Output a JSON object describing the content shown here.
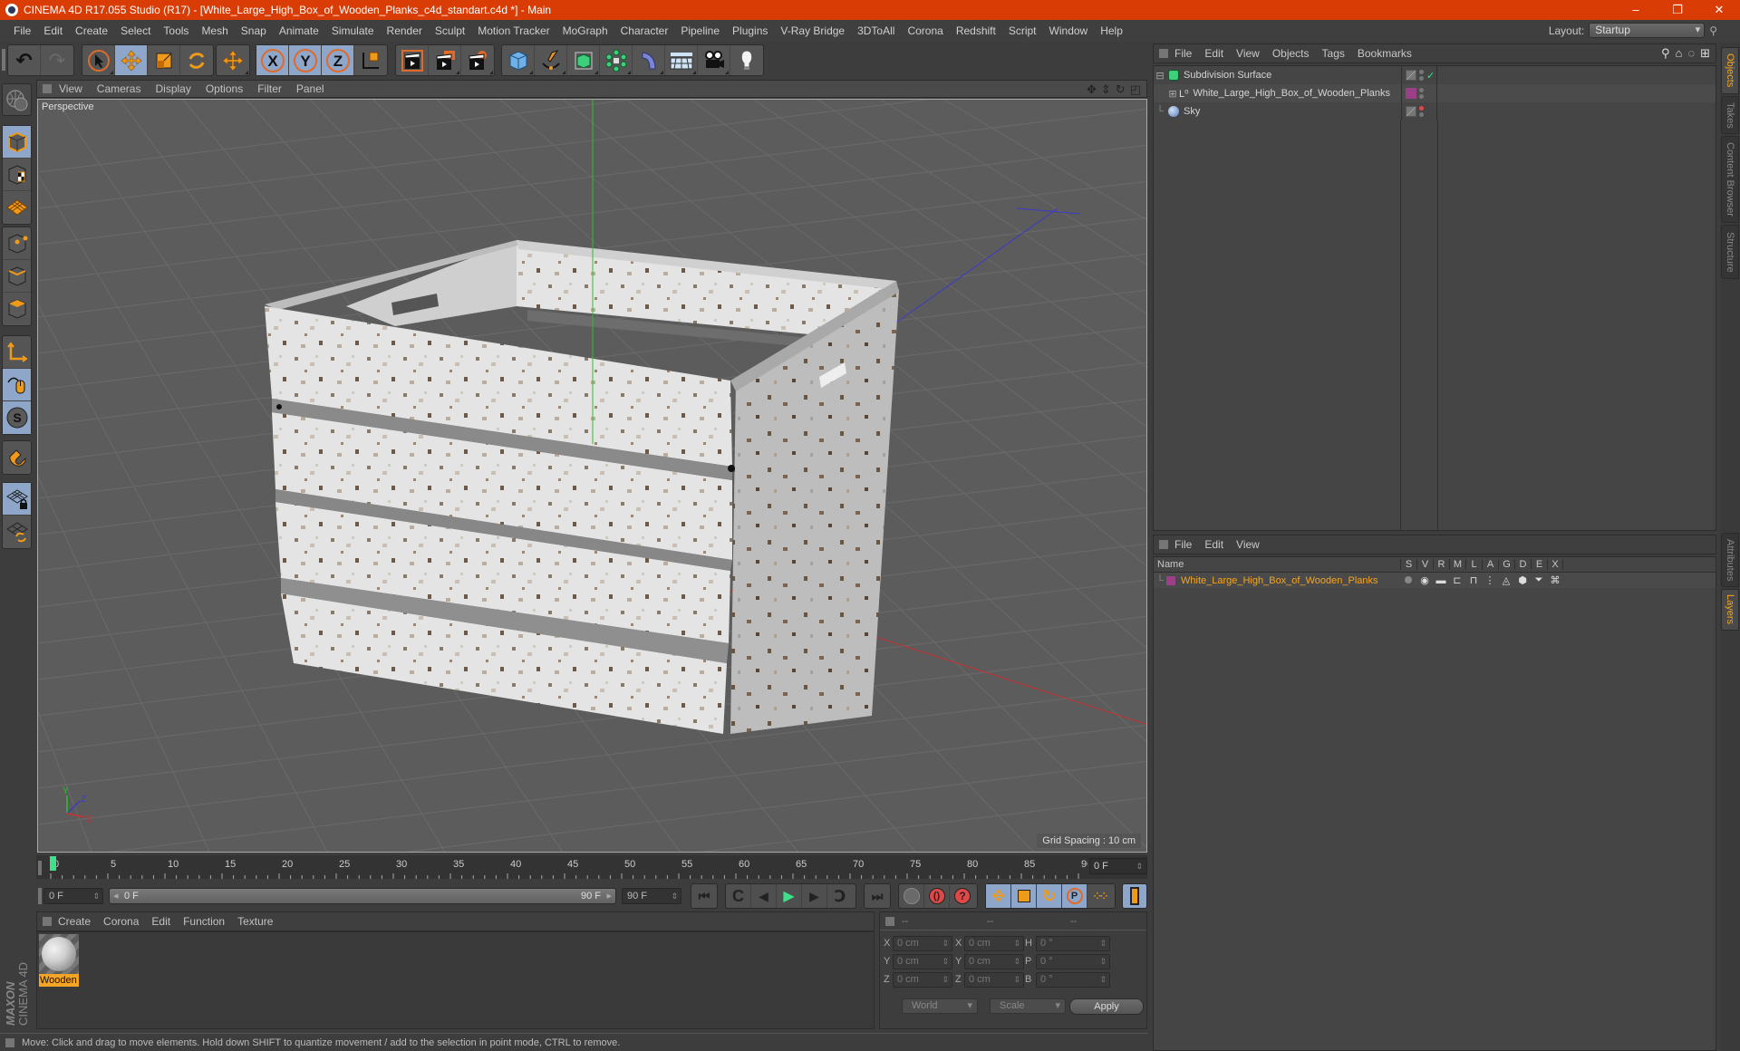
{
  "window": {
    "title": "CINEMA 4D R17.055 Studio (R17) - [White_Large_High_Box_of_Wooden_Planks_c4d_standart.c4d *] - Main",
    "controls": {
      "minimize": "–",
      "restore": "❐",
      "close": "✕"
    }
  },
  "menubar": {
    "items": [
      "File",
      "Edit",
      "Create",
      "Select",
      "Tools",
      "Mesh",
      "Snap",
      "Animate",
      "Simulate",
      "Render",
      "Sculpt",
      "Motion Tracker",
      "MoGraph",
      "Character",
      "Pipeline",
      "Plugins",
      "V-Ray Bridge",
      "3DToAll",
      "Corona",
      "Redshift",
      "Script",
      "Window",
      "Help"
    ],
    "layout_label": "Layout:",
    "layout_value": "Startup"
  },
  "toolbar": {
    "groups": [
      [
        "undo-icon",
        "redo-icon"
      ],
      [
        "select-arrow-icon",
        "move-icon",
        "scale-icon",
        "rotate-icon"
      ],
      [
        "move-alt-icon"
      ],
      [
        "x-axis-lock-icon",
        "y-axis-lock-icon",
        "z-axis-lock-icon",
        "coordinate-system-icon"
      ],
      [
        "render-view-icon",
        "render-picture-viewer-icon",
        "render-settings-icon"
      ],
      [
        "cube-primitive-icon",
        "pen-spline-icon",
        "subdivision-surface-icon",
        "mograph-cloner-icon",
        "deformer-bend-icon",
        "floor-scene-icon",
        "camera-icon",
        "light-icon"
      ]
    ],
    "axis_labels": [
      "X",
      "Y",
      "Z"
    ]
  },
  "left_tools": [
    "make-editable-icon",
    "model-mode-icon",
    "texture-mode-icon",
    "workplane-mode-icon",
    "points-mode-icon",
    "edges-mode-icon",
    "polygons-mode-icon",
    "axis-mode-icon",
    "tweak-mode-icon",
    "solo-mode-icon",
    "snap-magnet-icon",
    "lock-workplane-icon",
    "workplane-sync-icon"
  ],
  "viewport": {
    "menu": [
      "View",
      "Cameras",
      "Display",
      "Options",
      "Filter",
      "Panel"
    ],
    "label": "Perspective",
    "grid_spacing": "Grid Spacing : 10 cm",
    "axis_labels": {
      "x": "X",
      "y": "Y",
      "z": "Z"
    }
  },
  "timeline": {
    "ticks": [
      "0",
      "5",
      "10",
      "15",
      "20",
      "25",
      "30",
      "35",
      "40",
      "45",
      "50",
      "55",
      "60",
      "65",
      "70",
      "75",
      "80",
      "85",
      "90"
    ],
    "current_frame": "0 F",
    "start_field": "0 F",
    "range_start": "0 F",
    "range_end": "90 F",
    "end_field": "90 F"
  },
  "material_manager": {
    "menu": [
      "Create",
      "Corona",
      "Edit",
      "Function",
      "Texture"
    ],
    "materials": [
      {
        "name": "Wooden"
      }
    ],
    "brand_top": "MAXON",
    "brand_bottom": "CINEMA 4D"
  },
  "coordinates": {
    "headers": [
      "--",
      "--",
      "--"
    ],
    "rows": [
      {
        "l1": "X",
        "v1": "0 cm",
        "l2": "X",
        "v2": "0 cm",
        "l3": "H",
        "v3": "0 °"
      },
      {
        "l1": "Y",
        "v1": "0 cm",
        "l2": "Y",
        "v2": "0 cm",
        "l3": "P",
        "v3": "0 °"
      },
      {
        "l1": "Z",
        "v1": "0 cm",
        "l2": "Z",
        "v2": "0 cm",
        "l3": "B",
        "v3": "0 °"
      }
    ],
    "mode": "World",
    "transform": "Scale",
    "apply_label": "Apply"
  },
  "status": {
    "text": "Move: Click and drag to move elements. Hold down SHIFT to quantize movement / add to the selection in point mode, CTRL to remove."
  },
  "object_manager": {
    "menu": [
      "File",
      "Edit",
      "View",
      "Objects",
      "Tags",
      "Bookmarks"
    ],
    "objects": [
      {
        "name": "Subdivision Surface",
        "icon": "subdivision-surface-icon",
        "expander": "⊟",
        "enabled": "✓"
      },
      {
        "name": "White_Large_High_Box_of_Wooden_Planks",
        "icon": "null-object-icon",
        "expander": "⊞",
        "layer_color": "#9b3f86"
      },
      {
        "name": "Sky",
        "icon": "sky-icon",
        "expander": ""
      }
    ]
  },
  "layer_manager": {
    "menu": [
      "File",
      "Edit",
      "View"
    ],
    "columns": [
      "Name",
      "S",
      "V",
      "R",
      "M",
      "L",
      "A",
      "G",
      "D",
      "E",
      "X"
    ],
    "layers": [
      {
        "name": "White_Large_High_Box_of_Wooden_Planks",
        "color": "#9b3f86"
      }
    ]
  },
  "right_tabs": {
    "top": [
      "Objects",
      "Takes",
      "Content Browser",
      "Structure"
    ],
    "bottom": [
      "Attributes",
      "Layers"
    ]
  },
  "colors": {
    "titlebar": "#d93c05",
    "accent_orange": "#f3a523",
    "active_blue": "#8ea6c9",
    "layer_purple": "#9b3f86"
  }
}
